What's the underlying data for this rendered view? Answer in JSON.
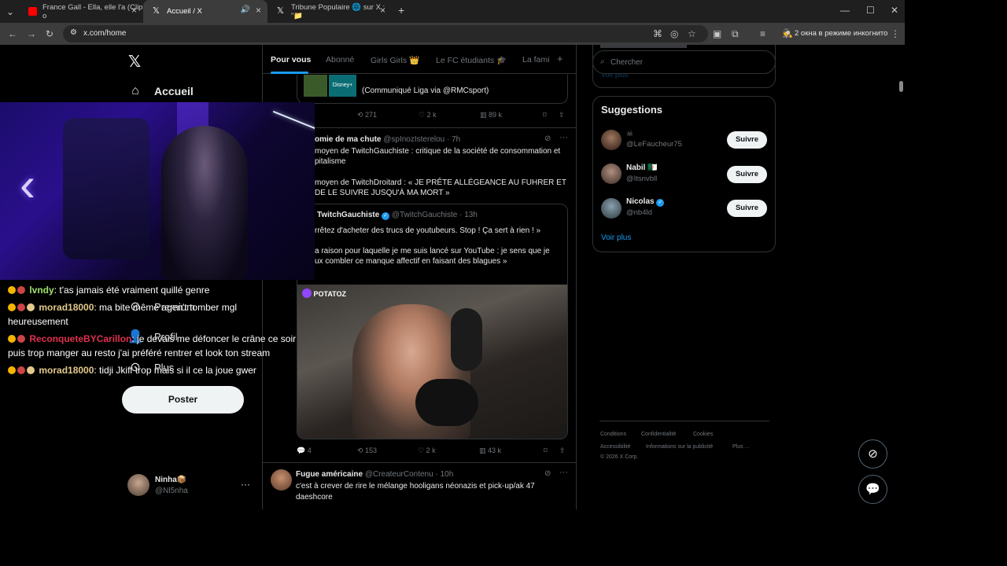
{
  "browser": {
    "tabs": [
      {
        "title": "France Gall - Ella, elle l'a (Clip o",
        "favicon_color": "#ff0000"
      },
      {
        "title": "Accueil / X",
        "favicon_color": "#ffffff"
      },
      {
        "title": "Tribune Populaire 🌐 sur X : \"📁",
        "favicon_color": "#ffffff"
      }
    ],
    "url": "x.com/home",
    "incognito_text": "2 окна в режиме инкогнито"
  },
  "nav": {
    "home_label": "Accueil",
    "premium_label": "Premium",
    "profile_label": "Profil",
    "more_label": "Plus",
    "post_label": "Poster",
    "account": {
      "name": "Ninha📦",
      "handle": "@Nl5nha"
    }
  },
  "feed": {
    "tabs": [
      "Pour vous",
      "Abonné",
      "Girls Girls 👑",
      "Le FC étudiants 🎓",
      "La fami"
    ],
    "post0": {
      "card_text": "(Communiqué Liga via @RMCsport)",
      "retweets": "271",
      "likes": "2 k",
      "views": "89 k"
    },
    "post1": {
      "name": "omie de ma chute",
      "handle": "@spInozIsterelou",
      "time": "· 7h",
      "text1a": "moyen de TwitchGauchiste : critique de la société de consommation et",
      "text1b": "pitalisme",
      "text2a": "moyen de TwitchDroitard : « JE PRÊTE ALLÉGEANCE AU FUHRER ET",
      "text2b": "DE LE SUIVRE JUSQU'À MA MORT »",
      "quote": {
        "name": "TwitchGauchiste",
        "handle": "@TwitchGauchiste",
        "time": "· 13h",
        "text1": "rrêtez d'acheter des trucs de youtubeurs. Stop ! Ça sert à rien ! »",
        "text2a": "a raison pour laquelle je me suis lancé sur YouTube : je sens que je",
        "text2b": "ux combler ce manque affectif en faisant des blagues »",
        "video_brand": "POTATOZ"
      },
      "replies": "4",
      "retweets": "153",
      "likes": "2 k",
      "views": "43 k"
    },
    "post2": {
      "name": "Fugue américaine",
      "handle": "@CreateurContenu",
      "time": "· 10h",
      "text1": "c'est à crever de rire le mélange hooligans néonazis et pick-up/ak 47",
      "text2": "daeshcore"
    }
  },
  "sidebar": {
    "search_placeholder": "Chercher",
    "top_link": "Voir plus",
    "suggestions_title": "Suggestions",
    "users": [
      {
        "name": "",
        "handle": "@LeFaucheur75",
        "follow": "Suivre"
      },
      {
        "name": "Nabil 🇩🇿",
        "handle": "@Itsnvbll",
        "follow": "Suivre"
      },
      {
        "name": "Nicolas",
        "handle": "@nb4ld",
        "follow": "Suivre",
        "verified": true
      }
    ],
    "see_more": "Voir plus",
    "footer": {
      "conditions": "Conditions",
      "privacy": "Confidentialité",
      "cookies": "Cookies",
      "accessibility": "Accessibilité",
      "ads_info": "Informations sur la publicité",
      "more": "Plus ...",
      "copyright": "© 2026 X Corp."
    }
  },
  "chat": [
    {
      "user": "lvndy",
      "user_color": "#9ee26d",
      "message": ": t'as jamais été vraiment quillé genre"
    },
    {
      "user": "morad18000",
      "user_color": "#e3c98b",
      "message": ": ma bite même agen't tomber mgl",
      "cont": "heureusement"
    },
    {
      "user": "ReconqueteBYCarillon",
      "user_color": "#e0314f",
      "message": ": je devais me défoncer le crâne ce soir",
      "cont": "puis trop manger au resto j'ai préféré rentrer et look ton stream"
    },
    {
      "user": "morad18000",
      "user_color": "#e3c98b",
      "message": ": tidji Jkiff trop mais si il ce la joue gwer"
    }
  ],
  "colors": {
    "accent": "#1d9bf0",
    "border": "#2f3336",
    "muted": "#71767b"
  }
}
